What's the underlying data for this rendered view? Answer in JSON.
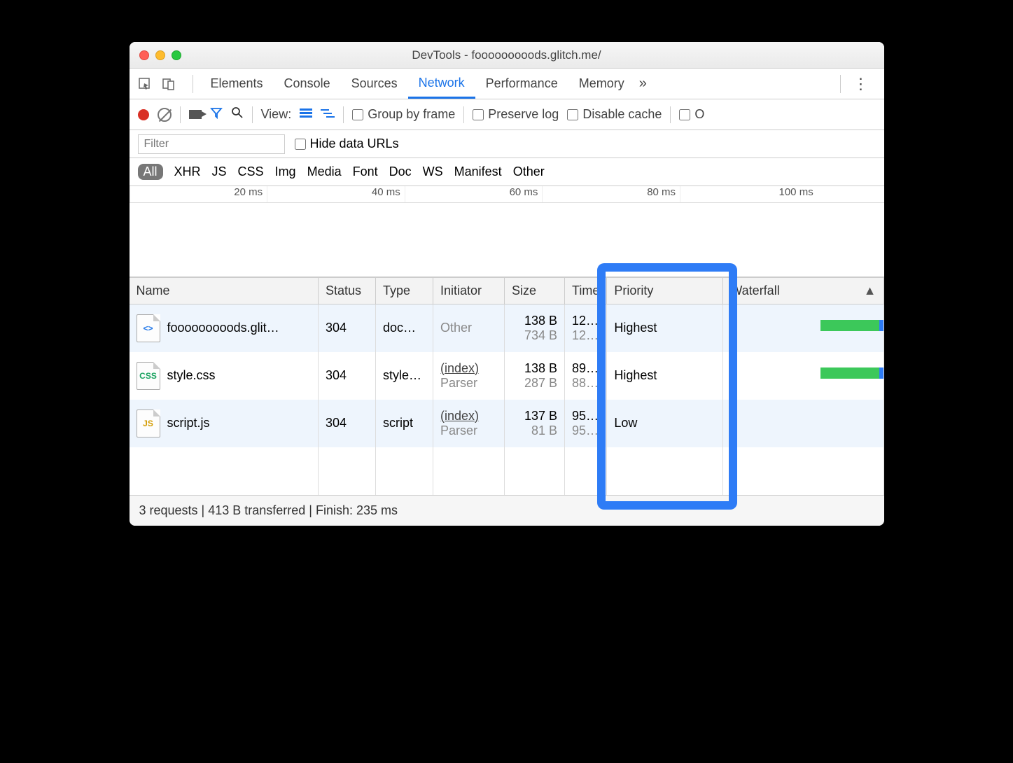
{
  "window": {
    "title": "DevTools - fooooooooods.glitch.me/"
  },
  "tabs": {
    "items": [
      "Elements",
      "Console",
      "Sources",
      "Network",
      "Performance",
      "Memory"
    ],
    "active": "Network",
    "more": "»"
  },
  "toolbar": {
    "view_label": "View:",
    "group_by_frame": "Group by frame",
    "preserve_log": "Preserve log",
    "disable_cache": "Disable cache"
  },
  "filter": {
    "placeholder": "Filter",
    "hide_data_urls": "Hide data URLs"
  },
  "types": [
    "All",
    "XHR",
    "JS",
    "CSS",
    "Img",
    "Media",
    "Font",
    "Doc",
    "WS",
    "Manifest",
    "Other"
  ],
  "types_active": "All",
  "timeline": {
    "ticks": [
      "20 ms",
      "40 ms",
      "60 ms",
      "80 ms",
      "100 ms"
    ]
  },
  "columns": {
    "name": "Name",
    "status": "Status",
    "type": "Type",
    "initiator": "Initiator",
    "size": "Size",
    "time": "Time",
    "priority": "Priority",
    "waterfall": "Waterfall"
  },
  "rows": [
    {
      "icon": "html",
      "icon_label": "<>",
      "name": "fooooooooods.glit…",
      "status": "304",
      "type": "doc…",
      "initiator": "Other",
      "initiator_sub": "",
      "size": "138 B",
      "size_sub": "734 B",
      "time": "12…",
      "time_sub": "12…",
      "priority": "Highest",
      "wf_width": 90
    },
    {
      "icon": "css",
      "icon_label": "CSS",
      "name": "style.css",
      "status": "304",
      "type": "style…",
      "initiator": "(index)",
      "initiator_sub": "Parser",
      "size": "138 B",
      "size_sub": "287 B",
      "time": "89…",
      "time_sub": "88…",
      "priority": "Highest",
      "wf_width": 90
    },
    {
      "icon": "js",
      "icon_label": "JS",
      "name": "script.js",
      "status": "304",
      "type": "script",
      "initiator": "(index)",
      "initiator_sub": "Parser",
      "size": "137 B",
      "size_sub": "81 B",
      "time": "95…",
      "time_sub": "95…",
      "priority": "Low",
      "wf_width": 0
    }
  ],
  "status_bar": "3 requests | 413 B transferred | Finish: 235 ms"
}
